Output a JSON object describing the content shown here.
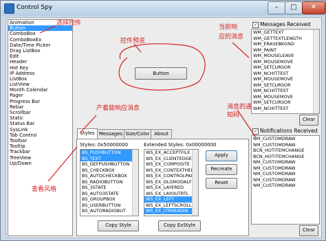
{
  "window": {
    "title": "Control Spy",
    "min_glyph": "–",
    "max_glyph": "□",
    "close_glyph": "✕"
  },
  "controls": {
    "items": [
      "Animation",
      "Button",
      "ComboBox",
      "ComboBoxEx",
      "Date/Time Picker",
      "Drag ListBox",
      "Edit",
      "Header",
      "Hot Key",
      "IP Address",
      "ListBox",
      "ListView",
      "Month Calendar",
      "Pager",
      "Progress Bar",
      "Rebar",
      "Scrollbar",
      "Static",
      "Status Bar",
      "SysLink",
      "Tab Control",
      "Toolbar",
      "Tooltip",
      "Trackbar",
      "TreeView",
      "Up/Down"
    ],
    "selected_index": 1
  },
  "preview": {
    "button_label": "Button"
  },
  "tabs": [
    "Styles",
    "Messages",
    "Size/Color",
    "About"
  ],
  "active_tab": 0,
  "styles": {
    "label": "Styles: 0x50000000",
    "items": [
      "BS_PUSHBUTTON",
      "BS_TEXT",
      "BS_DEFPUSHBUTTON",
      "BS_CHECKBOX",
      "BS_AUTOCHECKBOX",
      "BS_RADIOBUTTON",
      "BS_3STATE",
      "BS_AUTO3STATE",
      "BS_GROUPBOX",
      "BS_USERBUTTON",
      "BS_AUTORADIOBUT"
    ],
    "selected": [
      0,
      1
    ],
    "copy_label": "Copy Style"
  },
  "ex_styles": {
    "label": "Extended Styles: 0x00000000",
    "items": [
      "WS_EX_ACCEPTFILE",
      "WS_EX_CLIENTEDGE",
      "WS_EX_COMPOSITE",
      "WS_EX_CONTEXTHEL",
      "WS_EX_CONTROLPAI",
      "WS_EX_DLGMODALF",
      "WS_EX_LAYERED",
      "WS_EX_LAYOUTRTL",
      "WS_EX_LEFT",
      "WS_EX_LEFTSCROLL",
      "WS_EX_LTRREADIN"
    ],
    "selected": [
      8,
      10
    ],
    "copy_label": "Copy ExStyle"
  },
  "actions": {
    "apply": "Apply",
    "recreate": "Recreate",
    "reset": "Reset"
  },
  "messages": {
    "checkbox_label": "Messages Received",
    "checked": true,
    "items": [
      "WM_GETTEXT",
      "WM_GETTEXTLENGTH",
      "WM_ERASEBKGND",
      "WM_PAINT",
      "WM_MOUSELEAVE",
      "WM_MOUSEMOVE",
      "WM_SETCURSOR",
      "WM_NCHITTEST",
      "WM_MOUSEMOVE",
      "WM_SETCURSOR",
      "WM_NCHITTEST",
      "WM_MOUSEMOVE",
      "WM_SETCURSOR",
      "WM_NCHITTEST"
    ],
    "clear_label": "Clear"
  },
  "notifications": {
    "checkbox_label": "Notifications Received",
    "checked": true,
    "items": [
      "NM_CUSTOMDRAW",
      "NM_CUSTOMDRAW",
      "BCN_HOTITEMCHANGE",
      "BCN_HOTITEMCHANGE",
      "NM_CUSTOMDRAW",
      "NM_CUSTOMDRAW",
      "NM_CUSTOMDRAW",
      "NM_CUSTOMDRAW",
      "NM_CUSTOMDRAW"
    ],
    "clear_label": "Clear"
  },
  "annotations": {
    "select_control": "选择控件",
    "control_preview": "控件预览",
    "current_response": "当前响",
    "current_response2": "应的消息",
    "produce_response": "产着能响应消息",
    "notify_msg": "消息的通",
    "notify_msg2": "知码",
    "view_style": "查看风格"
  },
  "colors": {
    "accent": "#3399ff",
    "annotation": "#d32020"
  }
}
